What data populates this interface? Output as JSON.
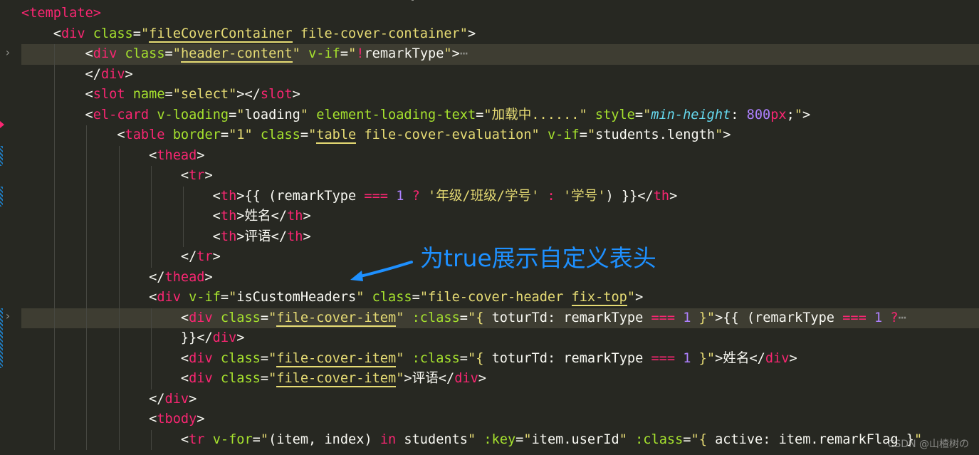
{
  "lines": [
    {
      "segs": [
        [
          "t",
          "<"
        ],
        [
          "t",
          "template"
        ],
        [
          "t",
          ">"
        ]
      ]
    },
    {
      "segs": [
        [
          "p",
          "    <"
        ],
        [
          "t",
          "div"
        ],
        [
          "p",
          " "
        ],
        [
          "a",
          "class"
        ],
        [
          "p",
          "="
        ],
        [
          "s",
          "\""
        ],
        [
          "sb",
          "fileCoverContainer"
        ],
        [
          "s",
          " file-cover-container\""
        ],
        [
          "p",
          ">"
        ]
      ]
    },
    {
      "segs": [
        [
          "p",
          "        <"
        ],
        [
          "t",
          "div"
        ],
        [
          "p",
          " "
        ],
        [
          "a",
          "class"
        ],
        [
          "p",
          "="
        ],
        [
          "s",
          "\""
        ],
        [
          "sb",
          "header-content"
        ],
        [
          "s",
          "\""
        ],
        [
          "p",
          " "
        ],
        [
          "a",
          "v-if"
        ],
        [
          "p",
          "="
        ],
        [
          "s",
          "\""
        ],
        [
          "t",
          "!"
        ],
        [
          "p",
          "remarkType"
        ],
        [
          "s",
          "\""
        ],
        [
          "p",
          ">"
        ],
        [
          "e",
          "⋯"
        ]
      ]
    },
    {
      "segs": [
        [
          "p",
          "        </"
        ],
        [
          "t",
          "div"
        ],
        [
          "p",
          ">"
        ]
      ]
    },
    {
      "segs": [
        [
          "p",
          "        <"
        ],
        [
          "t",
          "slot"
        ],
        [
          "p",
          " "
        ],
        [
          "a",
          "name"
        ],
        [
          "p",
          "="
        ],
        [
          "s",
          "\"select\""
        ],
        [
          "p",
          "></"
        ],
        [
          "t",
          "slot"
        ],
        [
          "p",
          ">"
        ]
      ]
    },
    {
      "segs": [
        [
          "p",
          "        <"
        ],
        [
          "t",
          "el-card"
        ],
        [
          "p",
          " "
        ],
        [
          "a",
          "v-loading"
        ],
        [
          "p",
          "="
        ],
        [
          "s",
          "\""
        ],
        [
          "p",
          "loading"
        ],
        [
          "s",
          "\""
        ],
        [
          "p",
          " "
        ],
        [
          "a",
          "element-loading-text"
        ],
        [
          "p",
          "="
        ],
        [
          "s",
          "\"加载中......\""
        ],
        [
          "p",
          " "
        ],
        [
          "a",
          "style"
        ],
        [
          "p",
          "="
        ],
        [
          "s",
          "\""
        ],
        [
          "i",
          "min-height"
        ],
        [
          "p",
          ": "
        ],
        [
          "n",
          "800"
        ],
        [
          "t",
          "px"
        ],
        [
          "p",
          ";"
        ],
        [
          "s",
          "\""
        ],
        [
          "p",
          ">"
        ]
      ]
    },
    {
      "segs": [
        [
          "p",
          "            <"
        ],
        [
          "t",
          "table"
        ],
        [
          "p",
          " "
        ],
        [
          "a",
          "border"
        ],
        [
          "p",
          "="
        ],
        [
          "s",
          "\"1\""
        ],
        [
          "p",
          " "
        ],
        [
          "a",
          "class"
        ],
        [
          "p",
          "="
        ],
        [
          "s",
          "\""
        ],
        [
          "sb",
          "table"
        ],
        [
          "s",
          " file-cover-evaluation\""
        ],
        [
          "p",
          " "
        ],
        [
          "a",
          "v-if"
        ],
        [
          "p",
          "="
        ],
        [
          "s",
          "\""
        ],
        [
          "p",
          "students.length"
        ],
        [
          "s",
          "\""
        ],
        [
          "p",
          ">"
        ]
      ]
    },
    {
      "segs": [
        [
          "p",
          "                <"
        ],
        [
          "t",
          "thead"
        ],
        [
          "p",
          ">"
        ]
      ]
    },
    {
      "segs": [
        [
          "p",
          "                    <"
        ],
        [
          "t",
          "tr"
        ],
        [
          "p",
          ">"
        ]
      ]
    },
    {
      "segs": [
        [
          "p",
          "                        <"
        ],
        [
          "t",
          "th"
        ],
        [
          "p",
          ">{{ ("
        ],
        [
          "p",
          "remarkType "
        ],
        [
          "t",
          "==="
        ],
        [
          "p",
          " "
        ],
        [
          "n",
          "1"
        ],
        [
          "p",
          " "
        ],
        [
          "t",
          "?"
        ],
        [
          "p",
          " "
        ],
        [
          "s",
          "'年级/班级/学号'"
        ],
        [
          "p",
          " "
        ],
        [
          "t",
          ":"
        ],
        [
          "p",
          " "
        ],
        [
          "s",
          "'学号'"
        ],
        [
          "p",
          ") }}</"
        ],
        [
          "t",
          "th"
        ],
        [
          "p",
          ">"
        ]
      ]
    },
    {
      "segs": [
        [
          "p",
          "                        <"
        ],
        [
          "t",
          "th"
        ],
        [
          "p",
          ">姓名</"
        ],
        [
          "t",
          "th"
        ],
        [
          "p",
          ">"
        ]
      ]
    },
    {
      "segs": [
        [
          "p",
          "                        <"
        ],
        [
          "t",
          "th"
        ],
        [
          "p",
          ">评语</"
        ],
        [
          "t",
          "th"
        ],
        [
          "p",
          ">"
        ]
      ]
    },
    {
      "segs": [
        [
          "p",
          "                    </"
        ],
        [
          "t",
          "tr"
        ],
        [
          "p",
          ">"
        ]
      ]
    },
    {
      "segs": [
        [
          "p",
          "                </"
        ],
        [
          "t",
          "thead"
        ],
        [
          "p",
          ">"
        ]
      ]
    },
    {
      "segs": [
        [
          "p",
          "                <"
        ],
        [
          "t",
          "div"
        ],
        [
          "p",
          " "
        ],
        [
          "a",
          "v-if"
        ],
        [
          "p",
          "="
        ],
        [
          "s",
          "\""
        ],
        [
          "p",
          "isCustomHeaders"
        ],
        [
          "s",
          "\""
        ],
        [
          "p",
          " "
        ],
        [
          "a",
          "class"
        ],
        [
          "p",
          "="
        ],
        [
          "s",
          "\"file-cover-header "
        ],
        [
          "sb",
          "fix-top"
        ],
        [
          "s",
          "\""
        ],
        [
          "p",
          ">"
        ]
      ]
    },
    {
      "segs": [
        [
          "p",
          "                    <"
        ],
        [
          "t",
          "div"
        ],
        [
          "p",
          " "
        ],
        [
          "a",
          "class"
        ],
        [
          "p",
          "="
        ],
        [
          "s",
          "\""
        ],
        [
          "sb",
          "file-cover-item"
        ],
        [
          "s",
          "\""
        ],
        [
          "p",
          " "
        ],
        [
          "a",
          ":class"
        ],
        [
          "p",
          "="
        ],
        [
          "s",
          "\""
        ],
        [
          "s",
          "{ "
        ],
        [
          "p",
          "toturTd: remarkType "
        ],
        [
          "t",
          "==="
        ],
        [
          "p",
          " "
        ],
        [
          "n",
          "1"
        ],
        [
          "s",
          " }\""
        ],
        [
          "p",
          ">{{ ("
        ],
        [
          "p",
          "remarkType "
        ],
        [
          "t",
          "==="
        ],
        [
          "p",
          " "
        ],
        [
          "n",
          "1"
        ],
        [
          "p",
          " "
        ],
        [
          "t",
          "?"
        ],
        [
          "e",
          "⋯"
        ]
      ]
    },
    {
      "segs": [
        [
          "p",
          "                    }}</"
        ],
        [
          "t",
          "div"
        ],
        [
          "p",
          ">"
        ]
      ]
    },
    {
      "segs": [
        [
          "p",
          "                    <"
        ],
        [
          "t",
          "div"
        ],
        [
          "p",
          " "
        ],
        [
          "a",
          "class"
        ],
        [
          "p",
          "="
        ],
        [
          "s",
          "\""
        ],
        [
          "sb",
          "file-cover-item"
        ],
        [
          "s",
          "\""
        ],
        [
          "p",
          " "
        ],
        [
          "a",
          ":class"
        ],
        [
          "p",
          "="
        ],
        [
          "s",
          "\""
        ],
        [
          "s",
          "{ "
        ],
        [
          "p",
          "toturTd: remarkType "
        ],
        [
          "t",
          "==="
        ],
        [
          "p",
          " "
        ],
        [
          "n",
          "1"
        ],
        [
          "s",
          " }\""
        ],
        [
          "p",
          ">姓名</"
        ],
        [
          "t",
          "div"
        ],
        [
          "p",
          ">"
        ]
      ]
    },
    {
      "segs": [
        [
          "p",
          "                    <"
        ],
        [
          "t",
          "div"
        ],
        [
          "p",
          " "
        ],
        [
          "a",
          "class"
        ],
        [
          "p",
          "="
        ],
        [
          "s",
          "\""
        ],
        [
          "sb",
          "file-cover-item"
        ],
        [
          "s",
          "\""
        ],
        [
          "p",
          ">评语</"
        ],
        [
          "t",
          "div"
        ],
        [
          "p",
          ">"
        ]
      ]
    },
    {
      "segs": [
        [
          "p",
          "                </"
        ],
        [
          "t",
          "div"
        ],
        [
          "p",
          ">"
        ]
      ]
    },
    {
      "segs": [
        [
          "p",
          "                <"
        ],
        [
          "t",
          "tbody"
        ],
        [
          "p",
          ">"
        ]
      ]
    },
    {
      "segs": [
        [
          "p",
          "                    <"
        ],
        [
          "t",
          "tr"
        ],
        [
          "p",
          " "
        ],
        [
          "a",
          "v-for"
        ],
        [
          "p",
          "="
        ],
        [
          "s",
          "\""
        ],
        [
          "p",
          "(item, "
        ],
        [
          "p",
          "index"
        ],
        [
          "p",
          ") "
        ],
        [
          "t",
          "in"
        ],
        [
          "p",
          " students"
        ],
        [
          "s",
          "\""
        ],
        [
          "p",
          " "
        ],
        [
          "a",
          ":key"
        ],
        [
          "p",
          "="
        ],
        [
          "s",
          "\""
        ],
        [
          "p",
          "item.userId"
        ],
        [
          "s",
          "\""
        ],
        [
          "p",
          " "
        ],
        [
          "a",
          ":class"
        ],
        [
          "p",
          "="
        ],
        [
          "s",
          "\""
        ],
        [
          "s",
          "{ "
        ],
        [
          "p",
          "active: item.remarkFlag }"
        ],
        [
          "s",
          "\""
        ]
      ]
    }
  ],
  "annotation": "为true展示自定义表头",
  "watermark": "CSDN @山楂树の",
  "colors": {
    "background": "#272822",
    "line_highlight": "#3e3d32",
    "tag": "#f92672",
    "attribute": "#a6e22e",
    "string": "#e6db74",
    "number": "#ae81ff",
    "annotation": "#1e90ff"
  },
  "gutter": {
    "fold_icons": [
      "chevron-right-icon",
      "chevron-right-icon"
    ],
    "breakpoint_icon": "breakpoint-marker-icon"
  }
}
